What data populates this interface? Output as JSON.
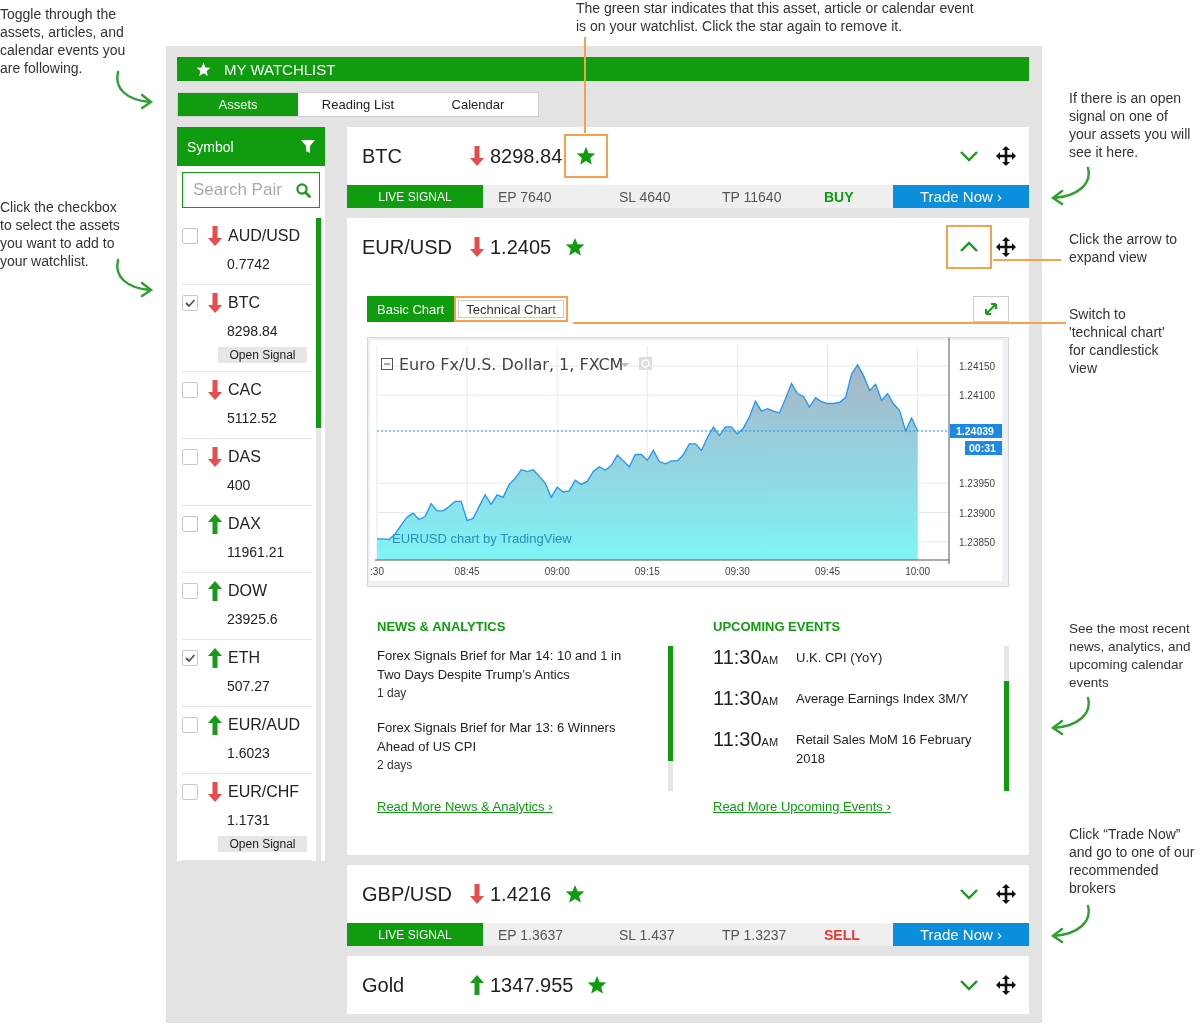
{
  "annotations": [
    {
      "text": "Toggle through the assets, articles, and calendar events you are following.",
      "kind": "arrow-right"
    },
    {
      "text": "The green star indicates that this asset, article or calendar event is on your watchlist. Click the star again to remove it.",
      "kind": "leader"
    },
    {
      "text": "If there is an open signal on one of your assets you will see it here.",
      "kind": "arrow-left"
    },
    {
      "text": "Click the checkbox to select the assets you want to add to your watchlist.",
      "kind": "arrow-right"
    },
    {
      "text": "Click the arrow to expand view",
      "kind": "leader"
    },
    {
      "text": "Switch to 'technical chart' for candlestick view",
      "kind": "leader"
    },
    {
      "text": "See the most recent news, analytics, and upcoming calendar events",
      "kind": "arrow-left"
    },
    {
      "text": "Click “Trade Now” and go to one of our recommended brokers",
      "kind": "arrow-left"
    }
  ],
  "watchlist": {
    "title": "MY WATCHLIST",
    "tabs": [
      {
        "label": "Assets",
        "selected": true
      },
      {
        "label": "Reading List",
        "selected": false
      },
      {
        "label": "Calendar",
        "selected": false
      }
    ],
    "sidebar": {
      "header": "Symbol",
      "search": {
        "placeholder": "Search Pair"
      },
      "items": [
        {
          "symbol": "AUD/USD",
          "price": "0.7742",
          "kind": "down",
          "checked": false
        },
        {
          "symbol": "BTC",
          "price": "8298.84",
          "kind": "down",
          "checked": true,
          "open_signal": "Open Signal"
        },
        {
          "symbol": "CAC",
          "price": "5112.52",
          "kind": "down",
          "checked": false
        },
        {
          "symbol": "DAS",
          "price": "400",
          "kind": "down",
          "checked": false
        },
        {
          "symbol": "DAX",
          "price": "11961.21",
          "kind": "up",
          "checked": false
        },
        {
          "symbol": "DOW",
          "price": "23925.6",
          "kind": "up",
          "checked": false
        },
        {
          "symbol": "ETH",
          "price": "507.27",
          "kind": "up",
          "checked": true
        },
        {
          "symbol": "EUR/AUD",
          "price": "1.6023",
          "kind": "up",
          "checked": false
        },
        {
          "symbol": "EUR/CHF",
          "price": "1.1731",
          "kind": "down",
          "checked": false,
          "open_signal": "Open Signal"
        }
      ]
    }
  },
  "assets": [
    {
      "symbol": "BTC",
      "kind": "down",
      "price": "8298.84",
      "starred": true,
      "expanded": false,
      "star_highlighted": true,
      "toggle_highlighted": false,
      "signal": {
        "label": "LIVE SIGNAL",
        "ep": "EP 7640",
        "sl": "SL 4640",
        "tp": "TP 11640",
        "action": "BUY",
        "kind": "buy",
        "button": "Trade Now ›"
      }
    },
    {
      "symbol": "EUR/USD",
      "kind": "down",
      "price": "1.2405",
      "starred": true,
      "expanded": true,
      "star_highlighted": false,
      "toggle_highlighted": true,
      "chart_tabs": [
        {
          "label": "Basic Chart",
          "selected": true,
          "highlighted": false
        },
        {
          "label": "Technical Chart",
          "selected": false,
          "highlighted": true
        }
      ],
      "chart": {
        "countdown": "00:31",
        "credit": "EURUSD chart by TradingView",
        "chart_data": {
          "type": "area",
          "title": "Euro Fx/U.S. Dollar, 1, FXCM",
          "grid": true,
          "ref_lines": [
            {
              "axis": "y",
              "value": 1.24039,
              "label": "1.24039",
              "color": "#1e88e5"
            }
          ],
          "categories": [
            ":30",
            null,
            null,
            null,
            null,
            null,
            null,
            null,
            null,
            null,
            null,
            null,
            null,
            null,
            null,
            "08:45",
            null,
            null,
            null,
            null,
            null,
            null,
            null,
            null,
            null,
            null,
            null,
            null,
            null,
            null,
            "09:00",
            null,
            null,
            null,
            null,
            null,
            null,
            null,
            null,
            null,
            null,
            null,
            null,
            null,
            null,
            "09:15",
            null,
            null,
            null,
            null,
            null,
            null,
            null,
            null,
            null,
            null,
            null,
            null,
            null,
            null,
            "09:30",
            null,
            null,
            null,
            null,
            null,
            null,
            null,
            null,
            null,
            null,
            null,
            null,
            null,
            null,
            "09:45",
            null,
            null,
            null,
            null,
            null,
            null,
            null,
            null,
            null,
            null,
            null,
            null,
            null,
            null,
            "10:00"
          ],
          "series": [
            {
              "color": "#2196f3",
              "values": [
                1.23855,
                1.23855,
                1.23854,
                1.23863,
                1.23878,
                1.23892,
                1.23899,
                1.23888,
                1.23893,
                1.23915,
                1.23903,
                1.23903,
                1.2391,
                1.23919,
                1.23919,
                1.23886,
                1.2389,
                1.2391,
                1.2393,
                1.23914,
                1.2393,
                1.23926,
                1.23948,
                1.23958,
                1.23973,
                1.2397,
                1.23973,
                1.23962,
                1.2395,
                1.23926,
                1.23943,
                1.23935,
                1.23937,
                1.23955,
                1.23948,
                1.23953,
                1.2397,
                1.23978,
                1.23972,
                1.2398,
                1.23998,
                1.23988,
                1.23978,
                1.23999,
                1.23999,
                1.23989,
                1.24006,
                1.23987,
                1.23983,
                1.23988,
                1.23988,
                1.23999,
                1.24017,
                1.24017,
                1.24006,
                1.24028,
                1.24046,
                1.24031,
                1.24046,
                1.24046,
                1.24034,
                1.24044,
                1.24063,
                1.2409,
                1.24073,
                1.24077,
                1.24073,
                1.2407,
                1.24094,
                1.2412,
                1.24103,
                1.24098,
                1.2408,
                1.24096,
                1.24089,
                1.24086,
                1.24086,
                1.24088,
                1.24096,
                1.24136,
                1.24152,
                1.24133,
                1.24108,
                1.24119,
                1.24091,
                1.24103,
                1.24085,
                1.24074,
                1.24039,
                1.24061,
                1.24039
              ]
            }
          ],
          "ylim": [
            1.23819,
            1.24184
          ],
          "yticks": [
            {
              "value": 1.2385,
              "label": "1.23850"
            },
            {
              "value": 1.239,
              "label": "1.23900"
            },
            {
              "value": 1.2395,
              "label": "1.23950"
            },
            {
              "value": 1.241,
              "label": "1.24100"
            },
            {
              "value": 1.2415,
              "label": "1.24150"
            }
          ]
        }
      },
      "news": {
        "title": "NEWS & ANALYTICS",
        "items": [
          {
            "title": "Forex Signals Brief for Mar 14: 10 and 1 in Two Days Despite Trump’s Antics",
            "age": "1 day"
          },
          {
            "title": "Forex Signals Brief for Mar 13: 6 Winners Ahead of US CPI",
            "age": "2 days"
          }
        ],
        "link": "Read More News & Analytics ›"
      },
      "events": {
        "title": "UPCOMING EVENTS",
        "items": [
          {
            "time": "11:30",
            "meridiem": "AM",
            "title": "U.K. CPI (YoY)"
          },
          {
            "time": "11:30",
            "meridiem": "AM",
            "title": "Average Earnings Index 3M/Y"
          },
          {
            "time": "11:30",
            "meridiem": "AM",
            "title": "Retail Sales MoM 16 February 2018"
          }
        ],
        "link": "Read More Upcoming Events ›"
      }
    },
    {
      "symbol": "GBP/USD",
      "kind": "down",
      "price": "1.4216",
      "starred": true,
      "expanded": false,
      "star_highlighted": false,
      "toggle_highlighted": false,
      "signal": {
        "label": "LIVE SIGNAL",
        "ep": "EP 1.3637",
        "sl": "SL 1.437",
        "tp": "TP 1.3237",
        "action": "SELL",
        "kind": "sell",
        "button": "Trade Now ›"
      }
    },
    {
      "symbol": "Gold",
      "kind": "up",
      "price": "1347.955",
      "starred": true,
      "expanded": false,
      "star_highlighted": false,
      "toggle_highlighted": false
    }
  ]
}
